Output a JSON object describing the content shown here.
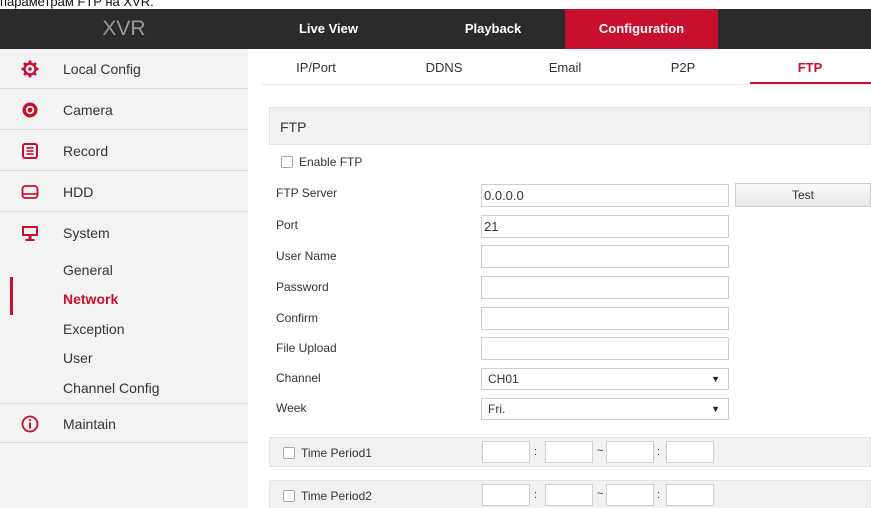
{
  "caption": "параметрам FTP на XVR.",
  "header": {
    "logo": "XVR",
    "tabs": [
      {
        "label": "Live View"
      },
      {
        "label": "Playback"
      },
      {
        "label": "Configuration",
        "active": true
      }
    ],
    "accent_color": "#c8102e"
  },
  "sidebar": {
    "items": [
      {
        "label": "Local Config",
        "icon": "gear-icon"
      },
      {
        "label": "Camera",
        "icon": "camera-lens-icon"
      },
      {
        "label": "Record",
        "icon": "record-icon"
      },
      {
        "label": "HDD",
        "icon": "hdd-icon"
      },
      {
        "label": "System",
        "icon": "monitor-icon"
      }
    ],
    "system_subitems": [
      {
        "label": "General"
      },
      {
        "label": "Network",
        "active": true
      },
      {
        "label": "Exception"
      },
      {
        "label": "User"
      },
      {
        "label": "Channel Config"
      }
    ],
    "maintain": {
      "label": "Maintain",
      "icon": "info-icon"
    }
  },
  "subtabs": [
    {
      "label": "IP/Port"
    },
    {
      "label": "DDNS"
    },
    {
      "label": "Email"
    },
    {
      "label": "P2P"
    },
    {
      "label": "FTP",
      "active": true
    }
  ],
  "ftp": {
    "section_title": "FTP",
    "enable_label": "Enable FTP",
    "enable_checked": false,
    "server_label": "FTP Server",
    "server_value": "0.0.0.0",
    "test_label": "Test",
    "port_label": "Port",
    "port_value": "21",
    "username_label": "User Name",
    "username_value": "",
    "password_label": "Password",
    "password_value": "",
    "confirm_label": "Confirm",
    "confirm_value": "",
    "file_upload_label": "File Upload",
    "file_upload_value": "",
    "channel_label": "Channel",
    "channel_value": "CH01",
    "week_label": "Week",
    "week_value": "Fri.",
    "time_periods": [
      {
        "label": "Time Period1",
        "checked": false
      },
      {
        "label": "Time Period2",
        "checked": false
      }
    ],
    "time_colon": ":",
    "time_range_sep": "~"
  }
}
